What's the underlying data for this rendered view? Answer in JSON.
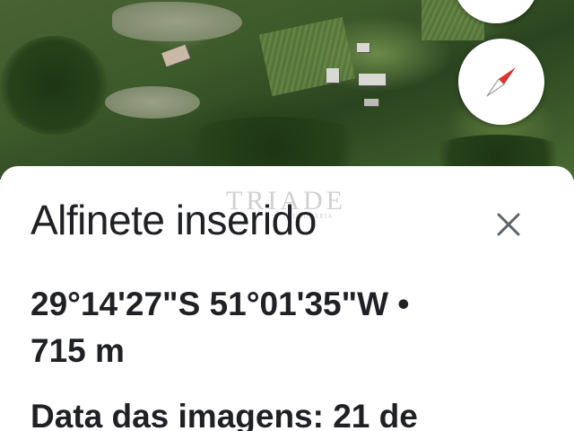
{
  "header": {
    "title": "Alfinete inserido",
    "close_icon": "close-icon"
  },
  "location": {
    "coordinates": "29°14'27\"S 51°01'35\"W •",
    "elevation": "715 m"
  },
  "imagery": {
    "date_label": "Data das imagens: 21 de"
  },
  "watermark": {
    "text": "TRIADE",
    "subtext": "IMOBILIÁRIA"
  },
  "map_controls": {
    "compass_icon": "compass-icon",
    "layers_icon": "map-control-icon"
  },
  "colors": {
    "compass_red": "#e53935",
    "compass_white": "#ffffff",
    "text": "#202124",
    "close_icon": "#5f6368"
  }
}
